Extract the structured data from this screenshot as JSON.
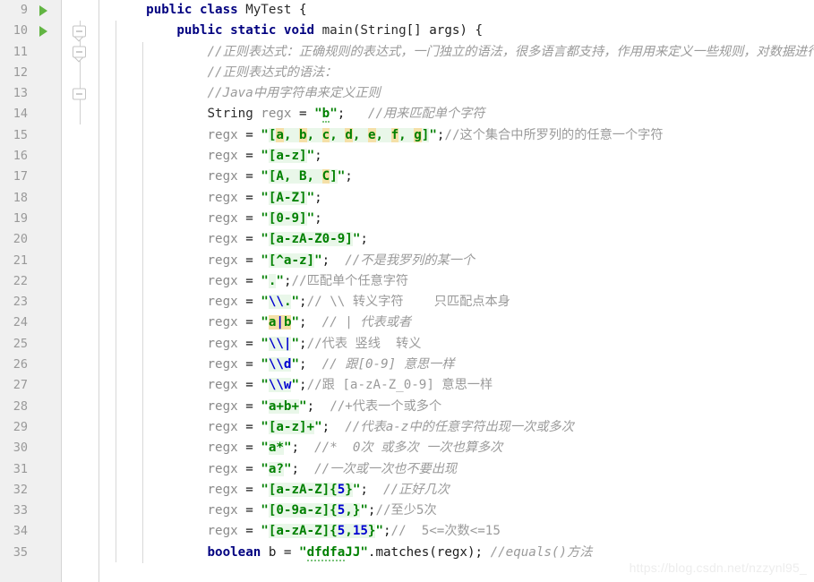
{
  "editor": {
    "app": "IntelliJ IDEA Java Editor",
    "language": "Java",
    "watermark": "https://blog.csdn.net/nzzynl95_",
    "colors": {
      "background": "#ffffff",
      "gutter_background": "#f0f0f0",
      "line_number": "#999999",
      "keyword": "#000080",
      "comment": "#9a9a9a",
      "string": "#008000",
      "regex_match_background": "#e9f7e9",
      "regex_group_background": "#f5e0a8",
      "regex_meta": "#0000d0",
      "run_marker": "#62b543",
      "typo_underline": "#7cc47c"
    },
    "first_line_number": 9,
    "last_line_number": 35
  },
  "lines": [
    {
      "number": "9",
      "run_marker": true,
      "fold_marker": "none",
      "text": "public class MyTest {"
    },
    {
      "number": "10",
      "run_marker": true,
      "fold_marker": "collapse",
      "text": "    public static void main(String[] args) {"
    },
    {
      "number": "11",
      "run_marker": false,
      "fold_marker": "collapse",
      "text": "        //正则表达式：正确规则的表达式，一门独立的语法，很多语言都支持，作用用来定义一些规则，对数据进行校验。"
    },
    {
      "number": "12",
      "run_marker": false,
      "fold_marker": "none",
      "text": "        //正则表达式的语法："
    },
    {
      "number": "13",
      "run_marker": false,
      "fold_marker": "collapse-end",
      "text": "        //Java中用字符串来定义正则"
    },
    {
      "number": "14",
      "run_marker": false,
      "fold_marker": "none",
      "text": "        String regx = \"b\";   //用来匹配单个字符"
    },
    {
      "number": "15",
      "run_marker": false,
      "fold_marker": "none",
      "text": "        regx = \"[a, b, c, d, e, f, g]\";//这个集合中所罗列的的任意一个字符"
    },
    {
      "number": "16",
      "run_marker": false,
      "fold_marker": "none",
      "text": "        regx = \"[a-z]\";"
    },
    {
      "number": "17",
      "run_marker": false,
      "fold_marker": "none",
      "text": "        regx = \"[A, B, C]\";"
    },
    {
      "number": "18",
      "run_marker": false,
      "fold_marker": "none",
      "text": "        regx = \"[A-Z]\";"
    },
    {
      "number": "19",
      "run_marker": false,
      "fold_marker": "none",
      "text": "        regx = \"[0-9]\";"
    },
    {
      "number": "20",
      "run_marker": false,
      "fold_marker": "none",
      "text": "        regx = \"[a-zA-Z0-9]\";"
    },
    {
      "number": "21",
      "run_marker": false,
      "fold_marker": "none",
      "text": "        regx = \"[^a-z]\";  //不是我罗列的某一个"
    },
    {
      "number": "22",
      "run_marker": false,
      "fold_marker": "none",
      "text": "        regx = \".\";//匹配单个任意字符"
    },
    {
      "number": "23",
      "run_marker": false,
      "fold_marker": "none",
      "text": "        regx = \"\\\\.\";// \\\\ 转义字符    只匹配点本身"
    },
    {
      "number": "24",
      "run_marker": false,
      "fold_marker": "none",
      "text": "        regx = \"a|b\";  // | 代表或者"
    },
    {
      "number": "25",
      "run_marker": false,
      "fold_marker": "none",
      "text": "        regx = \"\\\\|\";//代表 竖线  转义"
    },
    {
      "number": "26",
      "run_marker": false,
      "fold_marker": "none",
      "text": "        regx = \"\\\\d\";  // 跟[0-9] 意思一样"
    },
    {
      "number": "27",
      "run_marker": false,
      "fold_marker": "none",
      "text": "        regx = \"\\\\w\";//跟 [a-zA-Z_0-9] 意思一样"
    },
    {
      "number": "28",
      "run_marker": false,
      "fold_marker": "none",
      "text": "        regx = \"a+b+\";  //+代表一个或多个"
    },
    {
      "number": "29",
      "run_marker": false,
      "fold_marker": "none",
      "text": "        regx = \"[a-z]+\";  //代表a-z中的任意字符出现一次或多次"
    },
    {
      "number": "30",
      "run_marker": false,
      "fold_marker": "none",
      "text": "        regx = \"a*\";  //*  0次 或多次 一次也算多次"
    },
    {
      "number": "31",
      "run_marker": false,
      "fold_marker": "none",
      "text": "        regx = \"a?\";  //一次或一次也不要出现"
    },
    {
      "number": "32",
      "run_marker": false,
      "fold_marker": "none",
      "text": "        regx = \"[a-zA-Z]{5}\";  //正好几次"
    },
    {
      "number": "33",
      "run_marker": false,
      "fold_marker": "none",
      "text": "        regx = \"[0-9a-z]{5,}\";//至少5次"
    },
    {
      "number": "34",
      "run_marker": false,
      "fold_marker": "none",
      "text": "        regx = \"[a-zA-Z]{5,15}\";//  5<=次数<=15"
    },
    {
      "number": "35",
      "run_marker": false,
      "fold_marker": "none",
      "text": "        boolean b = \"dfdfaJJ\".matches(regx); //equals()方法"
    }
  ],
  "code_tokens": {
    "l9": [
      [
        "plain",
        "    "
      ],
      [
        "kw",
        "public class "
      ],
      [
        "ident",
        "MyTest"
      ],
      [
        "plain",
        " {"
      ]
    ],
    "l10": [
      [
        "plain",
        "        "
      ],
      [
        "kw",
        "public static void "
      ],
      [
        "ident",
        "main"
      ],
      [
        "plain",
        "("
      ],
      [
        "ident",
        "String"
      ],
      [
        "plain",
        "[] args) {"
      ]
    ],
    "l11": [
      [
        "plain",
        "            "
      ],
      [
        "comment",
        "//正则表达式：正确规则的表达式，一门独立的语法，很多语言都支持，作用用来定义一些规则，对数据进行校验。"
      ]
    ],
    "l12": [
      [
        "plain",
        "            "
      ],
      [
        "comment",
        "//正则表达式的语法："
      ]
    ],
    "l13": [
      [
        "plain",
        "            "
      ],
      [
        "comment",
        "//Java中用字符串来定义正则"
      ]
    ],
    "l14": [
      [
        "plain",
        "            "
      ],
      [
        "ident",
        "String"
      ],
      [
        "plain",
        " "
      ],
      [
        "local",
        "regx"
      ],
      [
        "plain",
        " = "
      ],
      [
        "str",
        "\""
      ],
      [
        "typo-str",
        "b"
      ],
      [
        "str",
        "\""
      ],
      [
        "plain",
        ";   "
      ],
      [
        "comment",
        "//用来匹配单个字符"
      ]
    ],
    "l15": [
      [
        "plain",
        "            "
      ],
      [
        "local",
        "regx"
      ],
      [
        "plain",
        " = "
      ],
      [
        "str",
        "\""
      ],
      [
        "rx",
        "["
      ],
      [
        "rx-hl",
        "a"
      ],
      [
        "rx",
        ", "
      ],
      [
        "rx-hl",
        "b"
      ],
      [
        "rx",
        ", "
      ],
      [
        "rx-hl",
        "c"
      ],
      [
        "rx",
        ", "
      ],
      [
        "rx-hl",
        "d"
      ],
      [
        "rx",
        ", "
      ],
      [
        "rx-hl",
        "e"
      ],
      [
        "rx",
        ", "
      ],
      [
        "rx-hl",
        "f"
      ],
      [
        "rx",
        ", "
      ],
      [
        "rx-hl",
        "g"
      ],
      [
        "rx",
        "]"
      ],
      [
        "str",
        "\""
      ],
      [
        "plain",
        ";"
      ],
      [
        "comment-n",
        "//这个集合中所罗列的的任意一个字符"
      ]
    ],
    "l16": [
      [
        "plain",
        "            "
      ],
      [
        "local",
        "regx"
      ],
      [
        "plain",
        " = "
      ],
      [
        "str",
        "\""
      ],
      [
        "rx",
        "[a-z]"
      ],
      [
        "str",
        "\""
      ],
      [
        "plain",
        ";"
      ]
    ],
    "l17": [
      [
        "plain",
        "            "
      ],
      [
        "local",
        "regx"
      ],
      [
        "plain",
        " = "
      ],
      [
        "str",
        "\""
      ],
      [
        "rx",
        "[A, B, "
      ],
      [
        "rx-hl",
        "C"
      ],
      [
        "rx",
        "]"
      ],
      [
        "str",
        "\""
      ],
      [
        "plain",
        ";"
      ]
    ],
    "l18": [
      [
        "plain",
        "            "
      ],
      [
        "local",
        "regx"
      ],
      [
        "plain",
        " = "
      ],
      [
        "str",
        "\""
      ],
      [
        "rx",
        "[A-Z]"
      ],
      [
        "str",
        "\""
      ],
      [
        "plain",
        ";"
      ]
    ],
    "l19": [
      [
        "plain",
        "            "
      ],
      [
        "local",
        "regx"
      ],
      [
        "plain",
        " = "
      ],
      [
        "str",
        "\""
      ],
      [
        "rx",
        "[0-9]"
      ],
      [
        "str",
        "\""
      ],
      [
        "plain",
        ";"
      ]
    ],
    "l20": [
      [
        "plain",
        "            "
      ],
      [
        "local",
        "regx"
      ],
      [
        "plain",
        " = "
      ],
      [
        "str",
        "\""
      ],
      [
        "rx",
        "[a-zA-Z0-9]"
      ],
      [
        "str",
        "\""
      ],
      [
        "plain",
        ";"
      ]
    ],
    "l21": [
      [
        "plain",
        "            "
      ],
      [
        "local",
        "regx"
      ],
      [
        "plain",
        " = "
      ],
      [
        "str",
        "\""
      ],
      [
        "rx",
        "[^a-z]"
      ],
      [
        "str",
        "\""
      ],
      [
        "plain",
        ";  "
      ],
      [
        "comment",
        "//不是我罗列的某一个"
      ]
    ],
    "l22": [
      [
        "plain",
        "            "
      ],
      [
        "local",
        "regx"
      ],
      [
        "plain",
        " = "
      ],
      [
        "str",
        "\""
      ],
      [
        "rx",
        "."
      ],
      [
        "str",
        "\""
      ],
      [
        "plain",
        ";"
      ],
      [
        "comment-n",
        "//匹配单个任意字符"
      ]
    ],
    "l23": [
      [
        "plain",
        "            "
      ],
      [
        "local",
        "regx"
      ],
      [
        "plain",
        " = "
      ],
      [
        "str",
        "\""
      ],
      [
        "rx-blue",
        "\\\\"
      ],
      [
        "rx",
        "."
      ],
      [
        "str",
        "\""
      ],
      [
        "plain",
        ";"
      ],
      [
        "comment-n",
        "// \\\\ 转义字符    只匹配点本身"
      ]
    ],
    "l24": [
      [
        "plain",
        "            "
      ],
      [
        "local",
        "regx"
      ],
      [
        "plain",
        " = "
      ],
      [
        "str",
        "\""
      ],
      [
        "rx-hl",
        "a"
      ],
      [
        "rx-hlblue",
        "|"
      ],
      [
        "rx-hl",
        "b"
      ],
      [
        "str",
        "\""
      ],
      [
        "plain",
        ";  "
      ],
      [
        "comment",
        "// | 代表或者"
      ]
    ],
    "l25": [
      [
        "plain",
        "            "
      ],
      [
        "local",
        "regx"
      ],
      [
        "plain",
        " = "
      ],
      [
        "str",
        "\""
      ],
      [
        "rx-blue",
        "\\\\|"
      ],
      [
        "str",
        "\""
      ],
      [
        "plain",
        ";"
      ],
      [
        "comment-n",
        "//代表 竖线  转义"
      ]
    ],
    "l26": [
      [
        "plain",
        "            "
      ],
      [
        "local",
        "regx"
      ],
      [
        "plain",
        " = "
      ],
      [
        "str",
        "\""
      ],
      [
        "rx-blue",
        "\\\\d"
      ],
      [
        "str",
        "\""
      ],
      [
        "plain",
        ";  "
      ],
      [
        "comment",
        "// 跟[0-9] 意思一样"
      ]
    ],
    "l27": [
      [
        "plain",
        "            "
      ],
      [
        "local",
        "regx"
      ],
      [
        "plain",
        " = "
      ],
      [
        "str",
        "\""
      ],
      [
        "rx-blue",
        "\\\\w"
      ],
      [
        "str",
        "\""
      ],
      [
        "plain",
        ";"
      ],
      [
        "comment-n",
        "//跟 [a-zA-Z_0-9] 意思一样"
      ]
    ],
    "l28": [
      [
        "plain",
        "            "
      ],
      [
        "local",
        "regx"
      ],
      [
        "plain",
        " = "
      ],
      [
        "str",
        "\""
      ],
      [
        "rx",
        "a+b+"
      ],
      [
        "str",
        "\""
      ],
      [
        "plain",
        ";  "
      ],
      [
        "comment-n",
        "//+代表一个或多个"
      ]
    ],
    "l29": [
      [
        "plain",
        "            "
      ],
      [
        "local",
        "regx"
      ],
      [
        "plain",
        " = "
      ],
      [
        "str",
        "\""
      ],
      [
        "rx",
        "[a-z]+"
      ],
      [
        "str",
        "\""
      ],
      [
        "plain",
        ";  "
      ],
      [
        "comment",
        "//代表a-z中的任意字符出现一次或多次"
      ]
    ],
    "l30": [
      [
        "plain",
        "            "
      ],
      [
        "local",
        "regx"
      ],
      [
        "plain",
        " = "
      ],
      [
        "str",
        "\""
      ],
      [
        "rx",
        "a*"
      ],
      [
        "str",
        "\""
      ],
      [
        "plain",
        ";  "
      ],
      [
        "comment",
        "//*  0次 或多次 一次也算多次"
      ]
    ],
    "l31": [
      [
        "plain",
        "            "
      ],
      [
        "local",
        "regx"
      ],
      [
        "plain",
        " = "
      ],
      [
        "str",
        "\""
      ],
      [
        "rx",
        "a?"
      ],
      [
        "str",
        "\""
      ],
      [
        "plain",
        ";  "
      ],
      [
        "comment",
        "//一次或一次也不要出现"
      ]
    ],
    "l32": [
      [
        "plain",
        "            "
      ],
      [
        "local",
        "regx"
      ],
      [
        "plain",
        " = "
      ],
      [
        "str",
        "\""
      ],
      [
        "rx",
        "[a-zA-Z]{"
      ],
      [
        "rx-blue",
        "5"
      ],
      [
        "rx",
        "}"
      ],
      [
        "str",
        "\""
      ],
      [
        "plain",
        ";  "
      ],
      [
        "comment",
        "//正好几次"
      ]
    ],
    "l33": [
      [
        "plain",
        "            "
      ],
      [
        "local",
        "regx"
      ],
      [
        "plain",
        " = "
      ],
      [
        "str",
        "\""
      ],
      [
        "rx",
        "[0-9a-z]{"
      ],
      [
        "rx-blue",
        "5"
      ],
      [
        "rx",
        ",}"
      ],
      [
        "str",
        "\""
      ],
      [
        "plain",
        ";"
      ],
      [
        "comment-n",
        "//至少5次"
      ]
    ],
    "l34": [
      [
        "plain",
        "            "
      ],
      [
        "local",
        "regx"
      ],
      [
        "plain",
        " = "
      ],
      [
        "str",
        "\""
      ],
      [
        "rx",
        "[a-zA-Z]{"
      ],
      [
        "rx-blue",
        "5"
      ],
      [
        "rx",
        ","
      ],
      [
        "rx-blue",
        "15"
      ],
      [
        "rx",
        "}"
      ],
      [
        "str",
        "\""
      ],
      [
        "plain",
        ";"
      ],
      [
        "comment-n",
        "//  5<=次数<=15"
      ]
    ],
    "l35": [
      [
        "plain",
        "            "
      ],
      [
        "kw",
        "boolean"
      ],
      [
        "plain",
        " b = "
      ],
      [
        "str",
        "\""
      ],
      [
        "typo-str",
        "dfdfa"
      ],
      [
        "str",
        "JJ"
      ],
      [
        "str",
        "\""
      ],
      [
        "plain",
        ".matches(regx); "
      ],
      [
        "comment",
        "//equals()方法"
      ]
    ]
  }
}
